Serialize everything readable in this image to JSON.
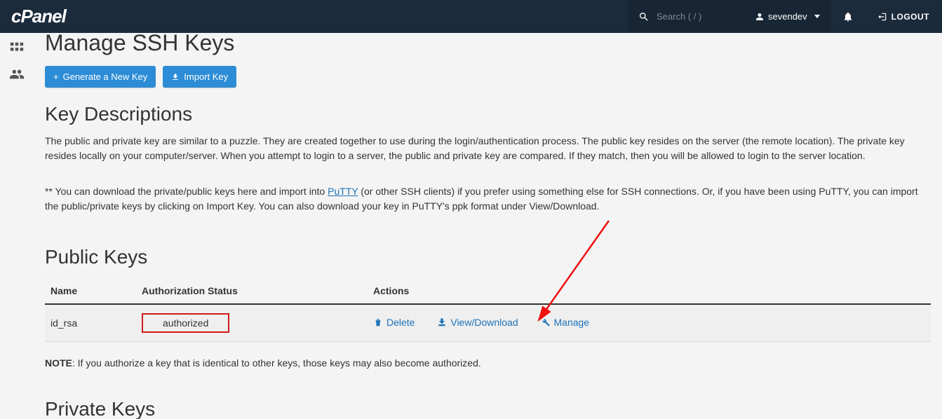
{
  "header": {
    "logo_text": "cPanel",
    "search_placeholder": "Search ( / )",
    "username": "sevendev",
    "logout_label": "LOGOUT"
  },
  "page": {
    "title": "Manage SSH Keys",
    "generate_btn": "Generate a New Key",
    "import_btn": "Import Key",
    "desc_heading": "Key Descriptions",
    "desc_p1": "The public and private key are similar to a puzzle. They are created together to use during the login/authentication process. The public key resides on the server (the remote location). The private key resides locally on your computer/server. When you attempt to login to a server, the public and private key are compared. If they match, then you will be allowed to login to the server location.",
    "desc_p2_pre": "** You can download the private/public keys here and import into ",
    "desc_p2_link": "PuTTY",
    "desc_p2_post": " (or other SSH clients) if you prefer using something else for SSH connections. Or, if you have been using PuTTY, you can import the public/private keys by clicking on Import Key. You can also download your key in PuTTY's ppk format under View/Download.",
    "public_keys_heading": "Public Keys",
    "columns": {
      "name": "Name",
      "auth": "Authorization Status",
      "actions": "Actions"
    },
    "row": {
      "name": "id_rsa",
      "auth": "authorized"
    },
    "actions": {
      "delete": "Delete",
      "view": "View/Download",
      "manage": "Manage"
    },
    "note_label": "NOTE",
    "note_text": ": If you authorize a key that is identical to other keys, those keys may also become authorized.",
    "private_keys_heading": "Private Keys"
  }
}
